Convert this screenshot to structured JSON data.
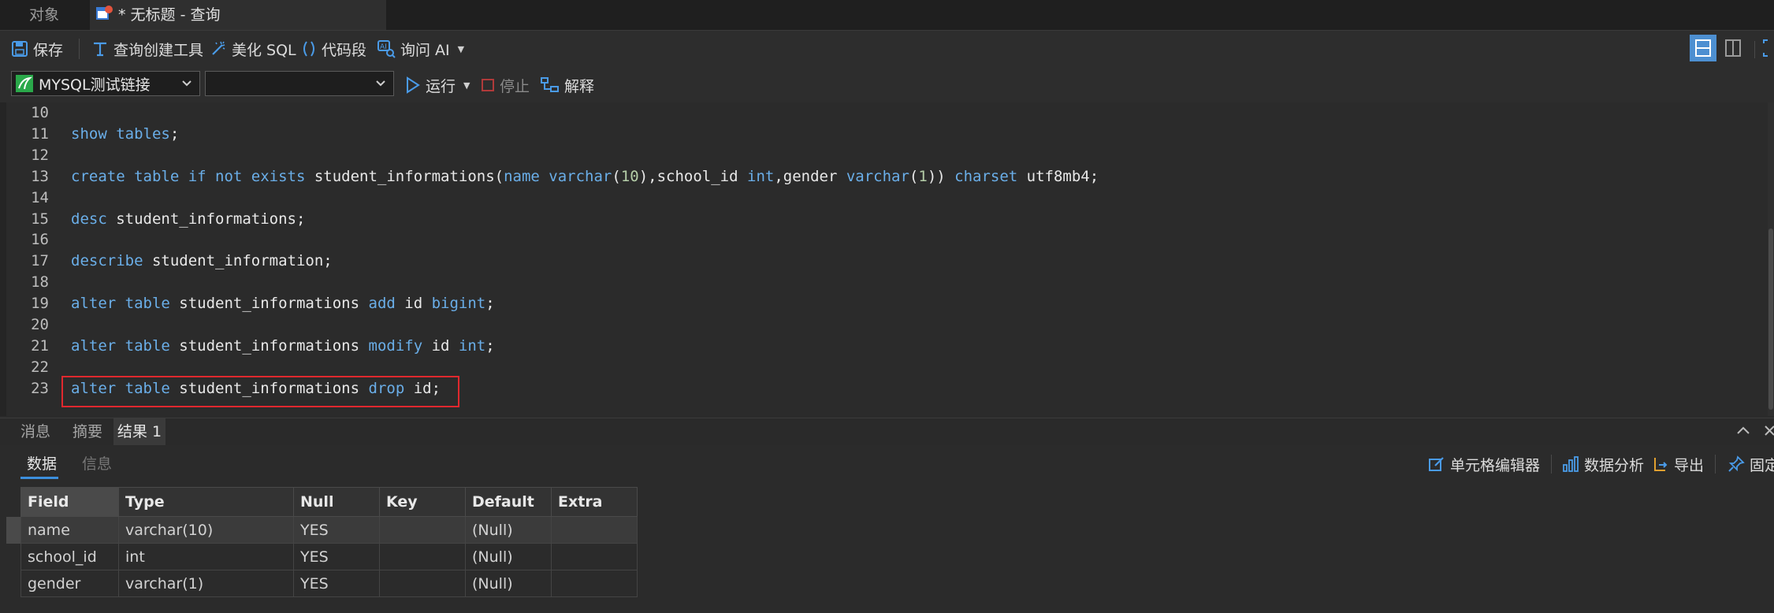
{
  "tabs": {
    "objects": "对象",
    "query": "* 无标题 - 查询"
  },
  "toolbar": {
    "save": "保存",
    "query_builder": "查询创建工具",
    "beautify": "美化 SQL",
    "snippet": "代码段",
    "ask_ai": "询问 AI"
  },
  "toolbar2": {
    "connection": "MYSQL测试链接",
    "database": "",
    "run": "运行",
    "stop": "停止",
    "explain": "解释"
  },
  "editor": {
    "lines": [
      {
        "n": "10",
        "html": ""
      },
      {
        "n": "11",
        "html": "<span class='kw'>show tables</span>;"
      },
      {
        "n": "12",
        "html": ""
      },
      {
        "n": "13",
        "html": "<span class='kw'>create table if not exists</span> student_informations(<span class='kw'>name varchar</span>(<span class='num'>10</span>),school_id <span class='kw'>int</span>,gender <span class='kw'>varchar</span>(<span class='num'>1</span>)) <span class='kw'>charset</span> utf8mb4;"
      },
      {
        "n": "14",
        "html": ""
      },
      {
        "n": "15",
        "html": "<span class='kw'>desc</span> student_informations;"
      },
      {
        "n": "16",
        "html": ""
      },
      {
        "n": "17",
        "html": "<span class='kw'>describe</span> student_information;"
      },
      {
        "n": "18",
        "html": ""
      },
      {
        "n": "19",
        "html": "<span class='kw'>alter table</span> student_informations <span class='kw'>add</span> id <span class='kw'>bigint</span>;"
      },
      {
        "n": "20",
        "html": ""
      },
      {
        "n": "21",
        "html": "<span class='kw'>alter table</span> student_informations <span class='kw'>modify</span> id <span class='kw'>int</span>;"
      },
      {
        "n": "22",
        "html": ""
      },
      {
        "n": "23",
        "html": "<span class='kw'>alter table</span> student_informations <span class='kw'>drop</span> id;"
      }
    ]
  },
  "result_tabs": {
    "messages": "消息",
    "summary": "摘要",
    "result1": "结果 1"
  },
  "data_tabs": {
    "data": "数据",
    "info": "信息"
  },
  "data_toolbar": {
    "cell_editor": "单元格编辑器",
    "analysis": "数据分析",
    "export": "导出",
    "pin": "固定"
  },
  "grid": {
    "columns": [
      "Field",
      "Type",
      "Null",
      "Key",
      "Default",
      "Extra"
    ],
    "rows": [
      [
        "name",
        "varchar(10)",
        "YES",
        "",
        "(Null)",
        ""
      ],
      [
        "school_id",
        "int",
        "YES",
        "",
        "(Null)",
        ""
      ],
      [
        "gender",
        "varchar(1)",
        "YES",
        "",
        "(Null)",
        ""
      ]
    ]
  },
  "colors": {
    "keyword": "#6aaee8",
    "number": "#b5cea8",
    "highlight_box": "#e0282e",
    "accent": "#3c8fdc"
  }
}
